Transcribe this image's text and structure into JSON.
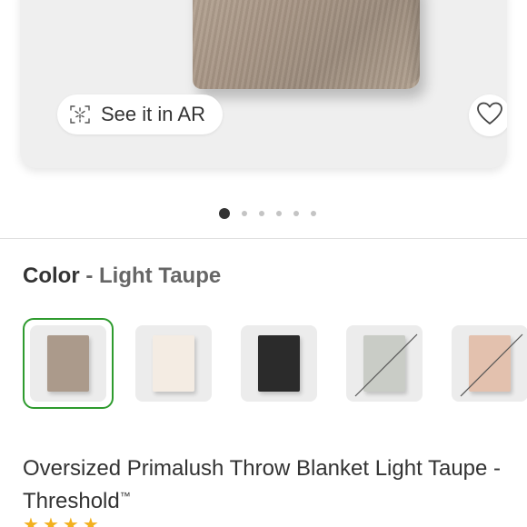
{
  "hero": {
    "ar_label": "See it in AR",
    "ar_icon": "ar-cube-icon",
    "favorite_icon": "heart-icon"
  },
  "carousel": {
    "total": 6,
    "active_index": 0
  },
  "color": {
    "label": "Color",
    "separator": "-",
    "value": "Light Taupe",
    "swatches": [
      {
        "name": "Light Taupe",
        "color": "#ab9a8b",
        "selected": true,
        "available": true
      },
      {
        "name": "Cream",
        "color": "#f4ece3",
        "selected": false,
        "available": true
      },
      {
        "name": "Black",
        "color": "#2b2b2b",
        "selected": false,
        "available": true
      },
      {
        "name": "Gray",
        "color": "#c9ccc6",
        "selected": false,
        "available": false
      },
      {
        "name": "Blush",
        "color": "#e3c1ae",
        "selected": false,
        "available": false
      }
    ],
    "selected_border_color": "#2e9b2e"
  },
  "product": {
    "title": "Oversized Primalush Throw Blanket Light Taupe - Threshold",
    "trademark": "™"
  }
}
